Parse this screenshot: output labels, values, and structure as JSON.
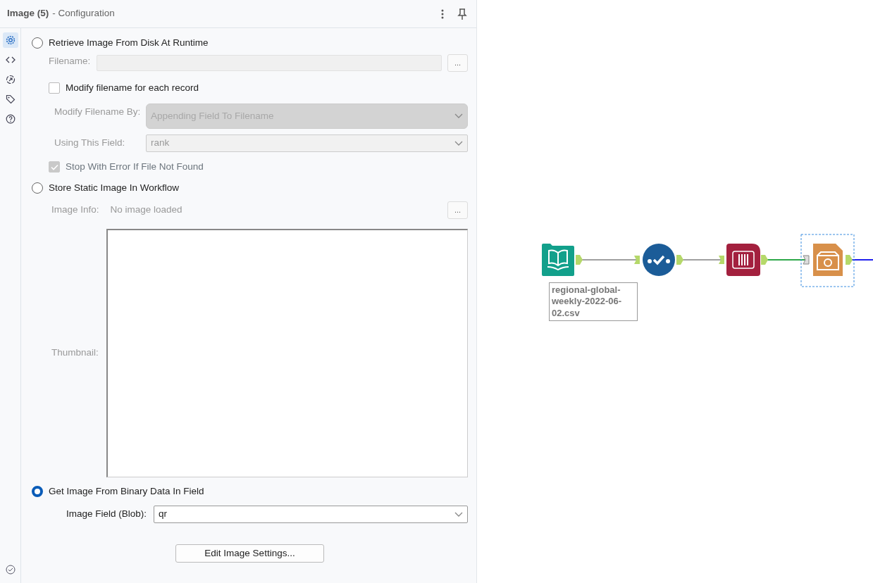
{
  "panel": {
    "title": "Image (5)",
    "subtitle": "- Configuration"
  },
  "side_tabs": [
    {
      "kind": "settings",
      "selected": true
    },
    {
      "kind": "code",
      "selected": false
    },
    {
      "kind": "link",
      "selected": false
    },
    {
      "kind": "tag",
      "selected": false
    },
    {
      "kind": "help",
      "selected": false
    }
  ],
  "options": [
    {
      "kind": "disk",
      "label": "Retrieve Image From Disk At Runtime",
      "selected": false,
      "filename_label": "Filename:",
      "browse": "...",
      "modify_checkbox": {
        "label": "Modify filename for each record",
        "checked": false
      },
      "modify_by": {
        "label": "Modify Filename By:",
        "value": "Appending Field To Filename"
      },
      "using_field": {
        "label": "Using This Field:",
        "value": "rank"
      },
      "stop_checkbox": {
        "label": "Stop With Error If File Not Found",
        "checked": true
      }
    },
    {
      "kind": "static",
      "label": "Store Static Image In Workflow",
      "selected": false,
      "info_label": "Image Info:",
      "info_value": "No image loaded",
      "browse": "...",
      "thumbnail_label": "Thumbnail:"
    },
    {
      "kind": "blob",
      "label": "Get Image From Binary Data In Field",
      "selected": true,
      "field_label": "Image Field (Blob):",
      "field_value": "qr"
    }
  ],
  "edit_button": "Edit Image Settings...",
  "workflow": {
    "nodes": [
      {
        "kind": "input",
        "selected": false,
        "label": "regional-global-weekly-2022-06-02.csv"
      },
      {
        "kind": "select",
        "selected": false
      },
      {
        "kind": "blob",
        "selected": false
      },
      {
        "kind": "image",
        "selected": true
      }
    ],
    "connections": [
      {
        "color": "#a0a0a0"
      },
      {
        "color": "#a0a0a0"
      },
      {
        "color": "#2ea84a"
      },
      {
        "color": "#2020ee"
      }
    ]
  }
}
